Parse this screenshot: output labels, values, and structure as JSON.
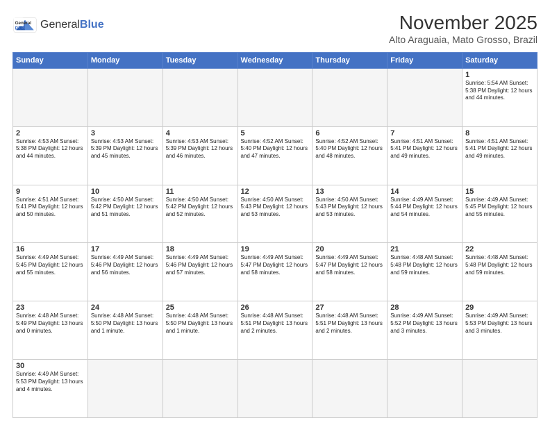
{
  "logo": {
    "text_normal": "General",
    "text_bold": "Blue"
  },
  "title": "November 2025",
  "subtitle": "Alto Araguaia, Mato Grosso, Brazil",
  "days_of_week": [
    "Sunday",
    "Monday",
    "Tuesday",
    "Wednesday",
    "Thursday",
    "Friday",
    "Saturday"
  ],
  "weeks": [
    [
      {
        "day": "",
        "info": ""
      },
      {
        "day": "",
        "info": ""
      },
      {
        "day": "",
        "info": ""
      },
      {
        "day": "",
        "info": ""
      },
      {
        "day": "",
        "info": ""
      },
      {
        "day": "",
        "info": ""
      },
      {
        "day": "1",
        "info": "Sunrise: 5:54 AM\nSunset: 5:38 PM\nDaylight: 12 hours\nand 44 minutes."
      }
    ],
    [
      {
        "day": "2",
        "info": "Sunrise: 4:53 AM\nSunset: 5:38 PM\nDaylight: 12 hours\nand 44 minutes."
      },
      {
        "day": "3",
        "info": "Sunrise: 4:53 AM\nSunset: 5:39 PM\nDaylight: 12 hours\nand 45 minutes."
      },
      {
        "day": "4",
        "info": "Sunrise: 4:53 AM\nSunset: 5:39 PM\nDaylight: 12 hours\nand 46 minutes."
      },
      {
        "day": "5",
        "info": "Sunrise: 4:52 AM\nSunset: 5:40 PM\nDaylight: 12 hours\nand 47 minutes."
      },
      {
        "day": "6",
        "info": "Sunrise: 4:52 AM\nSunset: 5:40 PM\nDaylight: 12 hours\nand 48 minutes."
      },
      {
        "day": "7",
        "info": "Sunrise: 4:51 AM\nSunset: 5:41 PM\nDaylight: 12 hours\nand 49 minutes."
      },
      {
        "day": "8",
        "info": "Sunrise: 4:51 AM\nSunset: 5:41 PM\nDaylight: 12 hours\nand 49 minutes."
      }
    ],
    [
      {
        "day": "9",
        "info": "Sunrise: 4:51 AM\nSunset: 5:41 PM\nDaylight: 12 hours\nand 50 minutes."
      },
      {
        "day": "10",
        "info": "Sunrise: 4:50 AM\nSunset: 5:42 PM\nDaylight: 12 hours\nand 51 minutes."
      },
      {
        "day": "11",
        "info": "Sunrise: 4:50 AM\nSunset: 5:42 PM\nDaylight: 12 hours\nand 52 minutes."
      },
      {
        "day": "12",
        "info": "Sunrise: 4:50 AM\nSunset: 5:43 PM\nDaylight: 12 hours\nand 53 minutes."
      },
      {
        "day": "13",
        "info": "Sunrise: 4:50 AM\nSunset: 5:43 PM\nDaylight: 12 hours\nand 53 minutes."
      },
      {
        "day": "14",
        "info": "Sunrise: 4:49 AM\nSunset: 5:44 PM\nDaylight: 12 hours\nand 54 minutes."
      },
      {
        "day": "15",
        "info": "Sunrise: 4:49 AM\nSunset: 5:45 PM\nDaylight: 12 hours\nand 55 minutes."
      }
    ],
    [
      {
        "day": "16",
        "info": "Sunrise: 4:49 AM\nSunset: 5:45 PM\nDaylight: 12 hours\nand 55 minutes."
      },
      {
        "day": "17",
        "info": "Sunrise: 4:49 AM\nSunset: 5:46 PM\nDaylight: 12 hours\nand 56 minutes."
      },
      {
        "day": "18",
        "info": "Sunrise: 4:49 AM\nSunset: 5:46 PM\nDaylight: 12 hours\nand 57 minutes."
      },
      {
        "day": "19",
        "info": "Sunrise: 4:49 AM\nSunset: 5:47 PM\nDaylight: 12 hours\nand 58 minutes."
      },
      {
        "day": "20",
        "info": "Sunrise: 4:49 AM\nSunset: 5:47 PM\nDaylight: 12 hours\nand 58 minutes."
      },
      {
        "day": "21",
        "info": "Sunrise: 4:48 AM\nSunset: 5:48 PM\nDaylight: 12 hours\nand 59 minutes."
      },
      {
        "day": "22",
        "info": "Sunrise: 4:48 AM\nSunset: 5:48 PM\nDaylight: 12 hours\nand 59 minutes."
      }
    ],
    [
      {
        "day": "23",
        "info": "Sunrise: 4:48 AM\nSunset: 5:49 PM\nDaylight: 13 hours\nand 0 minutes."
      },
      {
        "day": "24",
        "info": "Sunrise: 4:48 AM\nSunset: 5:50 PM\nDaylight: 13 hours\nand 1 minute."
      },
      {
        "day": "25",
        "info": "Sunrise: 4:48 AM\nSunset: 5:50 PM\nDaylight: 13 hours\nand 1 minute."
      },
      {
        "day": "26",
        "info": "Sunrise: 4:48 AM\nSunset: 5:51 PM\nDaylight: 13 hours\nand 2 minutes."
      },
      {
        "day": "27",
        "info": "Sunrise: 4:48 AM\nSunset: 5:51 PM\nDaylight: 13 hours\nand 2 minutes."
      },
      {
        "day": "28",
        "info": "Sunrise: 4:49 AM\nSunset: 5:52 PM\nDaylight: 13 hours\nand 3 minutes."
      },
      {
        "day": "29",
        "info": "Sunrise: 4:49 AM\nSunset: 5:53 PM\nDaylight: 13 hours\nand 3 minutes."
      }
    ],
    [
      {
        "day": "30",
        "info": "Sunrise: 4:49 AM\nSunset: 5:53 PM\nDaylight: 13 hours\nand 4 minutes."
      },
      {
        "day": "",
        "info": ""
      },
      {
        "day": "",
        "info": ""
      },
      {
        "day": "",
        "info": ""
      },
      {
        "day": "",
        "info": ""
      },
      {
        "day": "",
        "info": ""
      },
      {
        "day": "",
        "info": ""
      }
    ]
  ]
}
